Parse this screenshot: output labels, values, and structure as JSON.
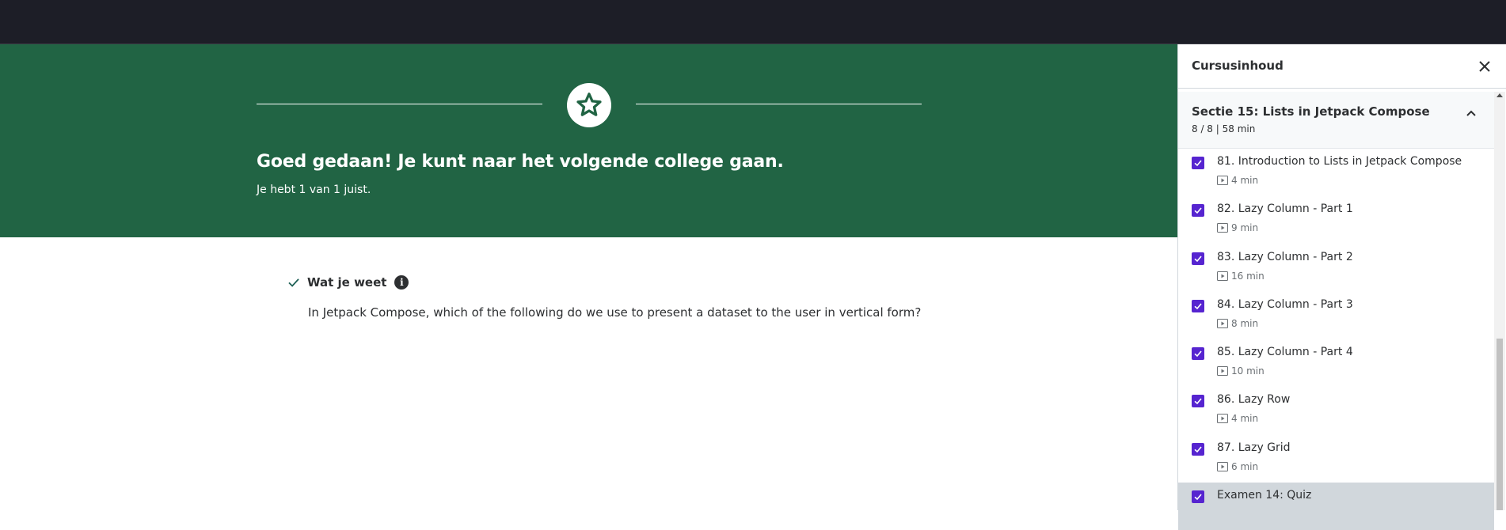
{
  "banner": {
    "title": "Goed gedaan! Je kunt naar het volgende college gaan.",
    "subtitle": "Je hebt 1 van 1 juist.",
    "icon": "star-icon",
    "color": "#216444"
  },
  "answer": {
    "label": "Wat je weet",
    "question": "In Jetpack Compose, which of the following do we use to present a dataset to the user in vertical form?"
  },
  "sidebar": {
    "title": "Cursusinhoud",
    "section": {
      "title": "Sectie 15: Lists in Jetpack Compose",
      "meta": "8 / 8 | 58 min"
    },
    "items": [
      {
        "name": "81. Introduction to Lists in Jetpack Compose",
        "duration": "4 min"
      },
      {
        "name": "82. Lazy Column - Part 1",
        "duration": "9 min"
      },
      {
        "name": "83. Lazy Column - Part 2",
        "duration": "16 min"
      },
      {
        "name": "84. Lazy Column - Part 3",
        "duration": "8 min"
      },
      {
        "name": "85. Lazy Column - Part 4",
        "duration": "10 min"
      },
      {
        "name": "86. Lazy Row",
        "duration": "4 min"
      },
      {
        "name": "87. Lazy Grid",
        "duration": "6 min"
      },
      {
        "name": "Examen 14: Quiz",
        "duration": ""
      }
    ],
    "accent": "#5624d0"
  }
}
